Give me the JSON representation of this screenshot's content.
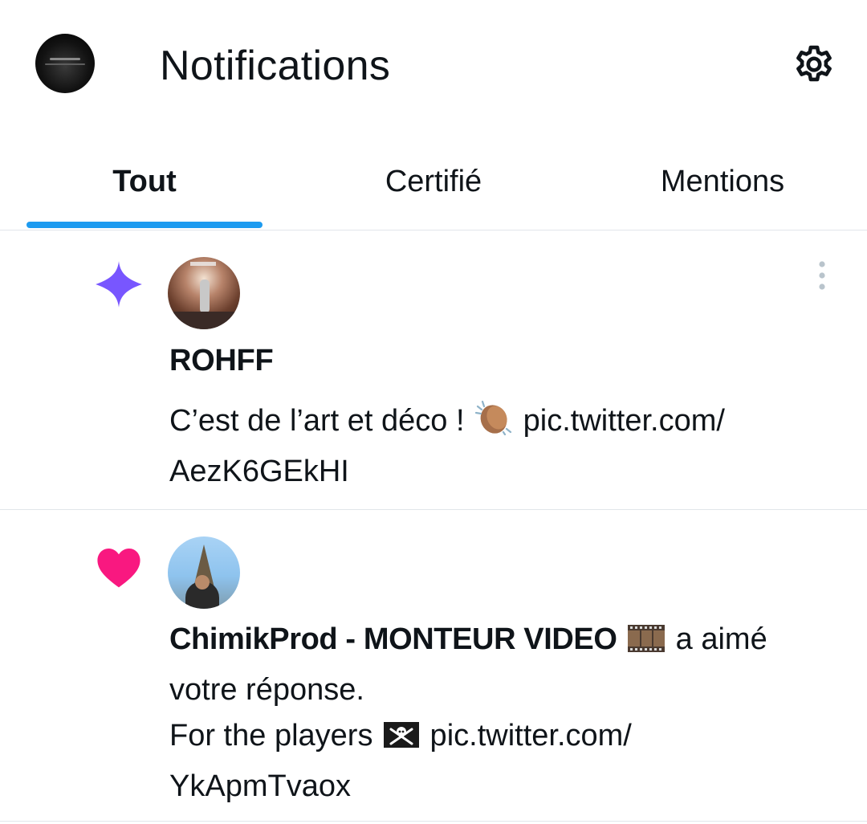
{
  "header": {
    "title": "Notifications",
    "avatar_icon": "profile-avatar",
    "settings_icon": "gear-icon"
  },
  "tabs": [
    {
      "label": "Tout",
      "active": true
    },
    {
      "label": "Certifié",
      "active": false
    },
    {
      "label": "Mentions",
      "active": false
    }
  ],
  "accent_color": "#1d9bf0",
  "notifications": [
    {
      "type_icon": "sparkle-icon",
      "type_color": "#7856ff",
      "author": "ROHFF",
      "text_before": "C’est de l’art et déco ! ",
      "emoji": "clapping-hands",
      "link_line1": " pic.twitter.com/",
      "link_line2": "AezK6GEkHI",
      "more_icon": "more-vertical-icon"
    },
    {
      "type_icon": "heart-icon",
      "type_color": "#f91880",
      "actor": "ChimikProd - MONTEUR VIDEO",
      "actor_emoji": "film-frames",
      "action": " a aimé votre réponse.",
      "reply_text": "For the players ",
      "reply_emoji": "pirate-flag",
      "link_line1": " pic.twitter.com/",
      "link_line2": "YkApmTvaox"
    }
  ]
}
